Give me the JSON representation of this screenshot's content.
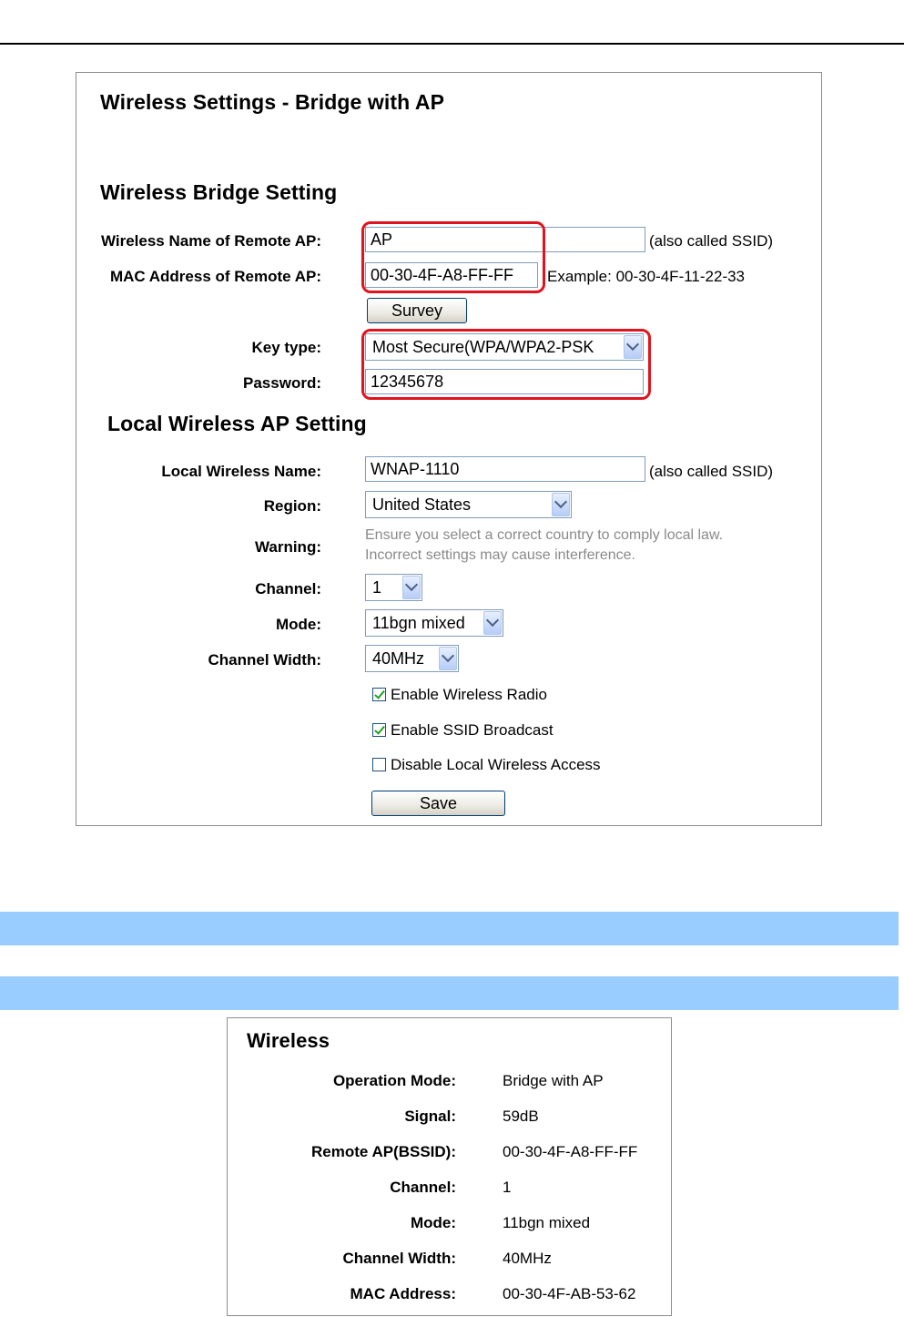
{
  "bridge": {
    "title": "Wireless Settings - Bridge with AP",
    "bridge_heading": "Wireless Bridge Setting",
    "remote_name_label": "Wireless Name of Remote AP:",
    "remote_name_value": "AP",
    "ssid_note": "(also called SSID)",
    "mac_label": "MAC Address of Remote AP:",
    "mac_value": "00-30-4F-A8-FF-FF",
    "mac_example": "Example: 00-30-4F-11-22-33",
    "survey_button": "Survey",
    "key_type_label": "Key type:",
    "key_type_value": "Most Secure(WPA/WPA2-PSK",
    "password_label": "Password:",
    "password_value": "12345678",
    "local_heading": "Local Wireless AP Setting",
    "local_name_label": "Local Wireless Name:",
    "local_name_value": "WNAP-1110",
    "local_ssid_note": "(also called SSID)",
    "region_label": "Region:",
    "region_value": "United States",
    "warning_label": "Warning:",
    "warning_line1": "Ensure you select a correct country to comply local law.",
    "warning_line2": "Incorrect settings may cause interference.",
    "channel_label": "Channel:",
    "channel_value": "1",
    "mode_label": "Mode:",
    "mode_value": "11bgn mixed",
    "width_label": "Channel Width:",
    "width_value": "40MHz",
    "enable_radio": {
      "label": "Enable Wireless Radio",
      "checked": true
    },
    "enable_ssid": {
      "label": "Enable SSID Broadcast",
      "checked": true
    },
    "disable_local": {
      "label": "Disable Local Wireless Access",
      "checked": false
    },
    "save_button": "Save"
  },
  "status": {
    "title": "Wireless",
    "rows": [
      {
        "label": "Operation Mode:",
        "value": "Bridge with AP"
      },
      {
        "label": "Signal:",
        "value": "59dB"
      },
      {
        "label": "Remote AP(BSSID):",
        "value": "00-30-4F-A8-FF-FF"
      },
      {
        "label": "Channel:",
        "value": "1"
      },
      {
        "label": "Mode:",
        "value": "11bgn mixed"
      },
      {
        "label": "Channel Width:",
        "value": "40MHz"
      },
      {
        "label": "MAC Address:",
        "value": "00-30-4F-AB-53-62"
      }
    ]
  },
  "colors": {
    "highlight": "#e0141e",
    "section_bar": "#99ccff",
    "warning_text": "#8a8a8a"
  }
}
